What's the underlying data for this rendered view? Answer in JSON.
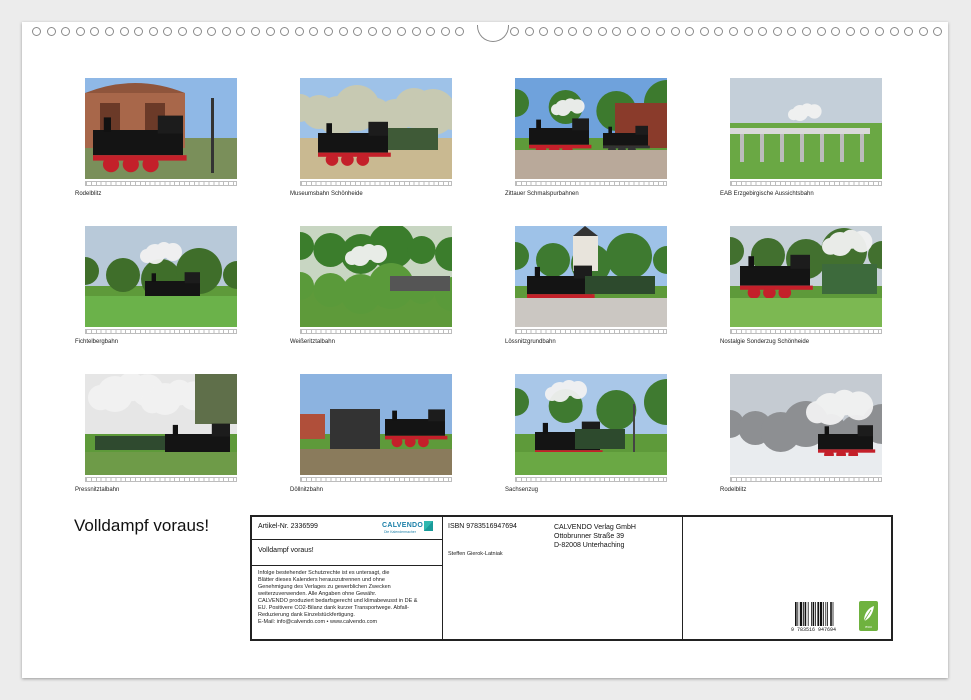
{
  "calendar": {
    "title": "Volldampf voraus!",
    "thumbnails": [
      {
        "caption": "Rodelblitz",
        "scene": "loco-shed"
      },
      {
        "caption": "Museumsbahn Schönheide",
        "scene": "forest"
      },
      {
        "caption": "Zittauer Schmalspurbahnen",
        "scene": "station"
      },
      {
        "caption": "EAB Erzgebirgische Aussichtsbahn",
        "scene": "viaduct"
      },
      {
        "caption": "Fichtelbergbahn",
        "scene": "meadow"
      },
      {
        "caption": "Weißeritztalbahn",
        "scene": "green-woods"
      },
      {
        "caption": "Lössnitzgrundbahn",
        "scene": "village"
      },
      {
        "caption": "Nostalgie Sonderzug Schönheide",
        "scene": "crossing"
      },
      {
        "caption": "Pressnitztalbahn",
        "scene": "big-smoke"
      },
      {
        "caption": "Döllnitzbahn",
        "scene": "depot"
      },
      {
        "caption": "Sachsenzug",
        "scene": "lamp-station"
      },
      {
        "caption": "Rodelblitz",
        "scene": "winter"
      }
    ]
  },
  "info": {
    "article": "Artikel-Nr. 2336599",
    "brand": "CALVENDO",
    "brand_sub": "Die Kalendermacher",
    "product_title": "Volldampf voraus!",
    "legal": [
      "Infolge bestehender Schutzrechte ist es untersagt, die",
      "Blätter dieses Kalenders herauszutrennen und ohne",
      "Genehmigung des Verlages zu gewerblichen Zwecken",
      "weiterzuverwenden. Alle Angaben ohne Gewähr.",
      "CALVENDO produziert bedarfsgerecht und klimabewusst in DE &",
      "EU. Positivere CO2-Bilanz dank kurzer Transportwege. Abfall-",
      "Reduzierung dank Einzelstückfertigung.",
      "E-Mail: info@calvendo.com • www.calvendo.com"
    ],
    "isbn": "ISBN 9783516947694",
    "author": "Steffen Gierok-Latniak",
    "publisher": [
      "CALVENDO Verlag GmbH",
      "Ottobrunner Straße 39",
      "D-82008 Unterhaching"
    ],
    "barcode_text": "9 783516 947694",
    "eco_label": "eco"
  },
  "colors": {
    "sky": "#8fb8e6",
    "grass": "#4f9a35",
    "loco": "#151515",
    "wheels": "#c4202a",
    "eco": "#6fb23f",
    "calvendo": "#1a7fa8"
  }
}
